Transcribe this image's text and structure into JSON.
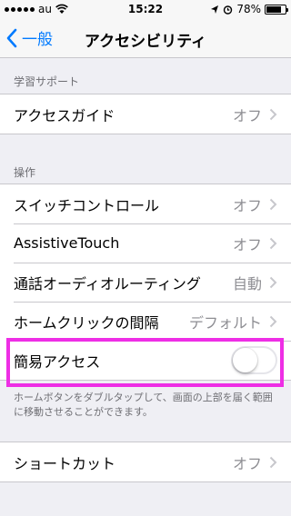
{
  "status_bar": {
    "carrier": "au",
    "time": "15:22",
    "battery": "78%",
    "battery_level": 0.78
  },
  "nav": {
    "back_label": "一般",
    "title": "アクセシビリティ"
  },
  "sections": {
    "learning": {
      "header": "学習サポート",
      "rows": [
        {
          "label": "アクセスガイド",
          "value": "オフ"
        }
      ]
    },
    "interaction": {
      "header": "操作",
      "rows": [
        {
          "label": "スイッチコントロール",
          "value": "オフ"
        },
        {
          "label": "AssistiveTouch",
          "value": "オフ"
        },
        {
          "label": "通話オーディオルーティング",
          "value": "自動"
        },
        {
          "label": "ホームクリックの間隔",
          "value": "デフォルト"
        },
        {
          "label": "簡易アクセス",
          "value": "",
          "toggle": "off"
        }
      ],
      "footer": "ホームボタンをダブルタップして、画面の上部を届く範囲に移動させることができます。"
    },
    "shortcut": {
      "rows": [
        {
          "label": "ショートカット",
          "value": "オフ"
        }
      ]
    }
  },
  "colors": {
    "accent": "#007aff",
    "highlight": "#ee2ee5",
    "background": "#efeff4"
  }
}
